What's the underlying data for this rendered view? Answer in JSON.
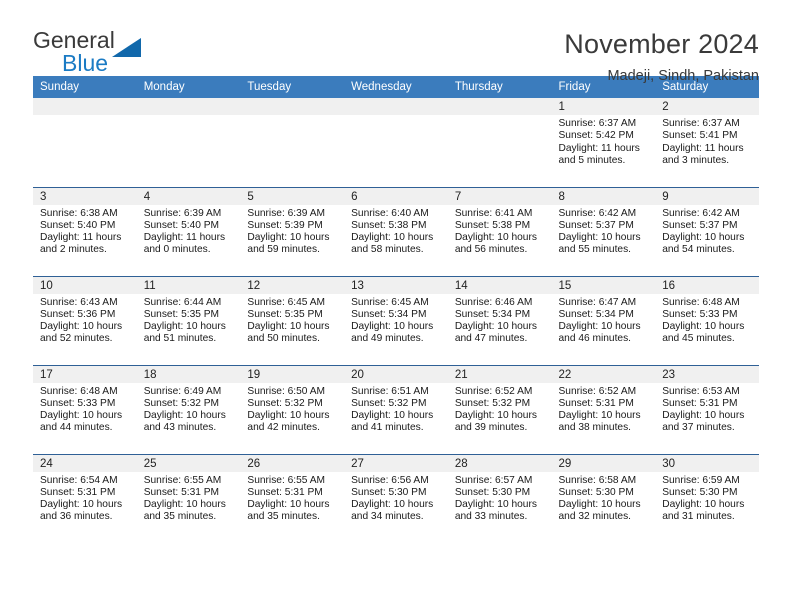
{
  "brand": {
    "word_one": "General",
    "word_two": "Blue",
    "triangle_color": "#1168ab",
    "accent_color": "#1b7bc4"
  },
  "header": {
    "title": "November 2024",
    "location": "Madeji, Sindh, Pakistan"
  },
  "theme": {
    "header_row_bg": "#3b7cbd",
    "row_divider": "#2f6096",
    "daynum_strip_bg": "#f0f0f0"
  },
  "weekdays": [
    "Sunday",
    "Monday",
    "Tuesday",
    "Wednesday",
    "Thursday",
    "Friday",
    "Saturday"
  ],
  "weeks": [
    [
      {
        "day": "",
        "blank": true
      },
      {
        "day": "",
        "blank": true
      },
      {
        "day": "",
        "blank": true
      },
      {
        "day": "",
        "blank": true
      },
      {
        "day": "",
        "blank": true
      },
      {
        "day": "1",
        "sunrise": "Sunrise: 6:37 AM",
        "sunset": "Sunset: 5:42 PM",
        "daylight": "Daylight: 11 hours and 5 minutes."
      },
      {
        "day": "2",
        "sunrise": "Sunrise: 6:37 AM",
        "sunset": "Sunset: 5:41 PM",
        "daylight": "Daylight: 11 hours and 3 minutes."
      }
    ],
    [
      {
        "day": "3",
        "sunrise": "Sunrise: 6:38 AM",
        "sunset": "Sunset: 5:40 PM",
        "daylight": "Daylight: 11 hours and 2 minutes."
      },
      {
        "day": "4",
        "sunrise": "Sunrise: 6:39 AM",
        "sunset": "Sunset: 5:40 PM",
        "daylight": "Daylight: 11 hours and 0 minutes."
      },
      {
        "day": "5",
        "sunrise": "Sunrise: 6:39 AM",
        "sunset": "Sunset: 5:39 PM",
        "daylight": "Daylight: 10 hours and 59 minutes."
      },
      {
        "day": "6",
        "sunrise": "Sunrise: 6:40 AM",
        "sunset": "Sunset: 5:38 PM",
        "daylight": "Daylight: 10 hours and 58 minutes."
      },
      {
        "day": "7",
        "sunrise": "Sunrise: 6:41 AM",
        "sunset": "Sunset: 5:38 PM",
        "daylight": "Daylight: 10 hours and 56 minutes."
      },
      {
        "day": "8",
        "sunrise": "Sunrise: 6:42 AM",
        "sunset": "Sunset: 5:37 PM",
        "daylight": "Daylight: 10 hours and 55 minutes."
      },
      {
        "day": "9",
        "sunrise": "Sunrise: 6:42 AM",
        "sunset": "Sunset: 5:37 PM",
        "daylight": "Daylight: 10 hours and 54 minutes."
      }
    ],
    [
      {
        "day": "10",
        "sunrise": "Sunrise: 6:43 AM",
        "sunset": "Sunset: 5:36 PM",
        "daylight": "Daylight: 10 hours and 52 minutes."
      },
      {
        "day": "11",
        "sunrise": "Sunrise: 6:44 AM",
        "sunset": "Sunset: 5:35 PM",
        "daylight": "Daylight: 10 hours and 51 minutes."
      },
      {
        "day": "12",
        "sunrise": "Sunrise: 6:45 AM",
        "sunset": "Sunset: 5:35 PM",
        "daylight": "Daylight: 10 hours and 50 minutes."
      },
      {
        "day": "13",
        "sunrise": "Sunrise: 6:45 AM",
        "sunset": "Sunset: 5:34 PM",
        "daylight": "Daylight: 10 hours and 49 minutes."
      },
      {
        "day": "14",
        "sunrise": "Sunrise: 6:46 AM",
        "sunset": "Sunset: 5:34 PM",
        "daylight": "Daylight: 10 hours and 47 minutes."
      },
      {
        "day": "15",
        "sunrise": "Sunrise: 6:47 AM",
        "sunset": "Sunset: 5:34 PM",
        "daylight": "Daylight: 10 hours and 46 minutes."
      },
      {
        "day": "16",
        "sunrise": "Sunrise: 6:48 AM",
        "sunset": "Sunset: 5:33 PM",
        "daylight": "Daylight: 10 hours and 45 minutes."
      }
    ],
    [
      {
        "day": "17",
        "sunrise": "Sunrise: 6:48 AM",
        "sunset": "Sunset: 5:33 PM",
        "daylight": "Daylight: 10 hours and 44 minutes."
      },
      {
        "day": "18",
        "sunrise": "Sunrise: 6:49 AM",
        "sunset": "Sunset: 5:32 PM",
        "daylight": "Daylight: 10 hours and 43 minutes."
      },
      {
        "day": "19",
        "sunrise": "Sunrise: 6:50 AM",
        "sunset": "Sunset: 5:32 PM",
        "daylight": "Daylight: 10 hours and 42 minutes."
      },
      {
        "day": "20",
        "sunrise": "Sunrise: 6:51 AM",
        "sunset": "Sunset: 5:32 PM",
        "daylight": "Daylight: 10 hours and 41 minutes."
      },
      {
        "day": "21",
        "sunrise": "Sunrise: 6:52 AM",
        "sunset": "Sunset: 5:32 PM",
        "daylight": "Daylight: 10 hours and 39 minutes."
      },
      {
        "day": "22",
        "sunrise": "Sunrise: 6:52 AM",
        "sunset": "Sunset: 5:31 PM",
        "daylight": "Daylight: 10 hours and 38 minutes."
      },
      {
        "day": "23",
        "sunrise": "Sunrise: 6:53 AM",
        "sunset": "Sunset: 5:31 PM",
        "daylight": "Daylight: 10 hours and 37 minutes."
      }
    ],
    [
      {
        "day": "24",
        "sunrise": "Sunrise: 6:54 AM",
        "sunset": "Sunset: 5:31 PM",
        "daylight": "Daylight: 10 hours and 36 minutes."
      },
      {
        "day": "25",
        "sunrise": "Sunrise: 6:55 AM",
        "sunset": "Sunset: 5:31 PM",
        "daylight": "Daylight: 10 hours and 35 minutes."
      },
      {
        "day": "26",
        "sunrise": "Sunrise: 6:55 AM",
        "sunset": "Sunset: 5:31 PM",
        "daylight": "Daylight: 10 hours and 35 minutes."
      },
      {
        "day": "27",
        "sunrise": "Sunrise: 6:56 AM",
        "sunset": "Sunset: 5:30 PM",
        "daylight": "Daylight: 10 hours and 34 minutes."
      },
      {
        "day": "28",
        "sunrise": "Sunrise: 6:57 AM",
        "sunset": "Sunset: 5:30 PM",
        "daylight": "Daylight: 10 hours and 33 minutes."
      },
      {
        "day": "29",
        "sunrise": "Sunrise: 6:58 AM",
        "sunset": "Sunset: 5:30 PM",
        "daylight": "Daylight: 10 hours and 32 minutes."
      },
      {
        "day": "30",
        "sunrise": "Sunrise: 6:59 AM",
        "sunset": "Sunset: 5:30 PM",
        "daylight": "Daylight: 10 hours and 31 minutes."
      }
    ]
  ]
}
